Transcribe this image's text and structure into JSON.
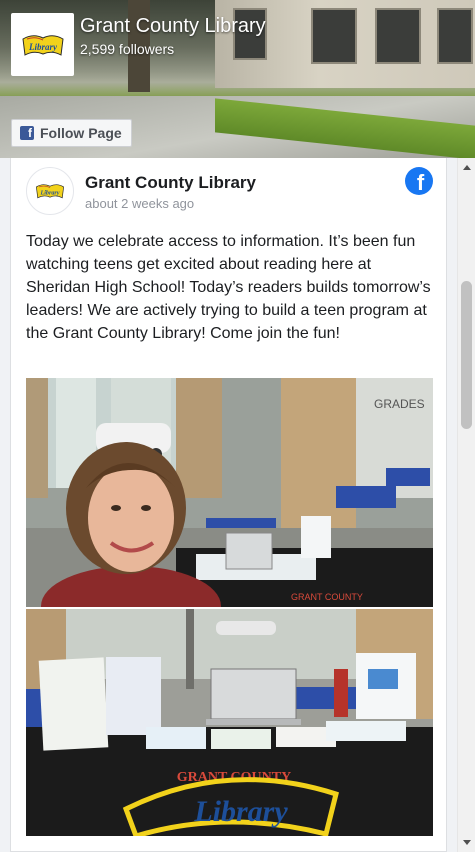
{
  "header": {
    "page_name": "Grant County Library",
    "followers": "2,599 followers",
    "follow_label": "Follow Page",
    "follow_icon": "facebook-icon",
    "logo_text": "Library"
  },
  "post": {
    "author": "Grant County Library",
    "time": "about 2 weeks ago",
    "text": "Today we celebrate access to information. It’s been fun watching teens get excited about reading here at Sheridan High School! Today’s readers builds tomorrow’s leaders! We are actively trying to build a teen program at the Grant County Library! Come join the fun!",
    "source_icon": "facebook-icon",
    "photo1_sign": "GRADES",
    "photo2_banner": "GRANT COUNTY",
    "photo2_logo": "Library"
  },
  "colors": {
    "facebook_blue": "#1877f2",
    "text": "#1c1e21",
    "meta": "#90949c",
    "table_cloth": "#1b1b1b",
    "logo_yellow": "#f2d21b"
  }
}
